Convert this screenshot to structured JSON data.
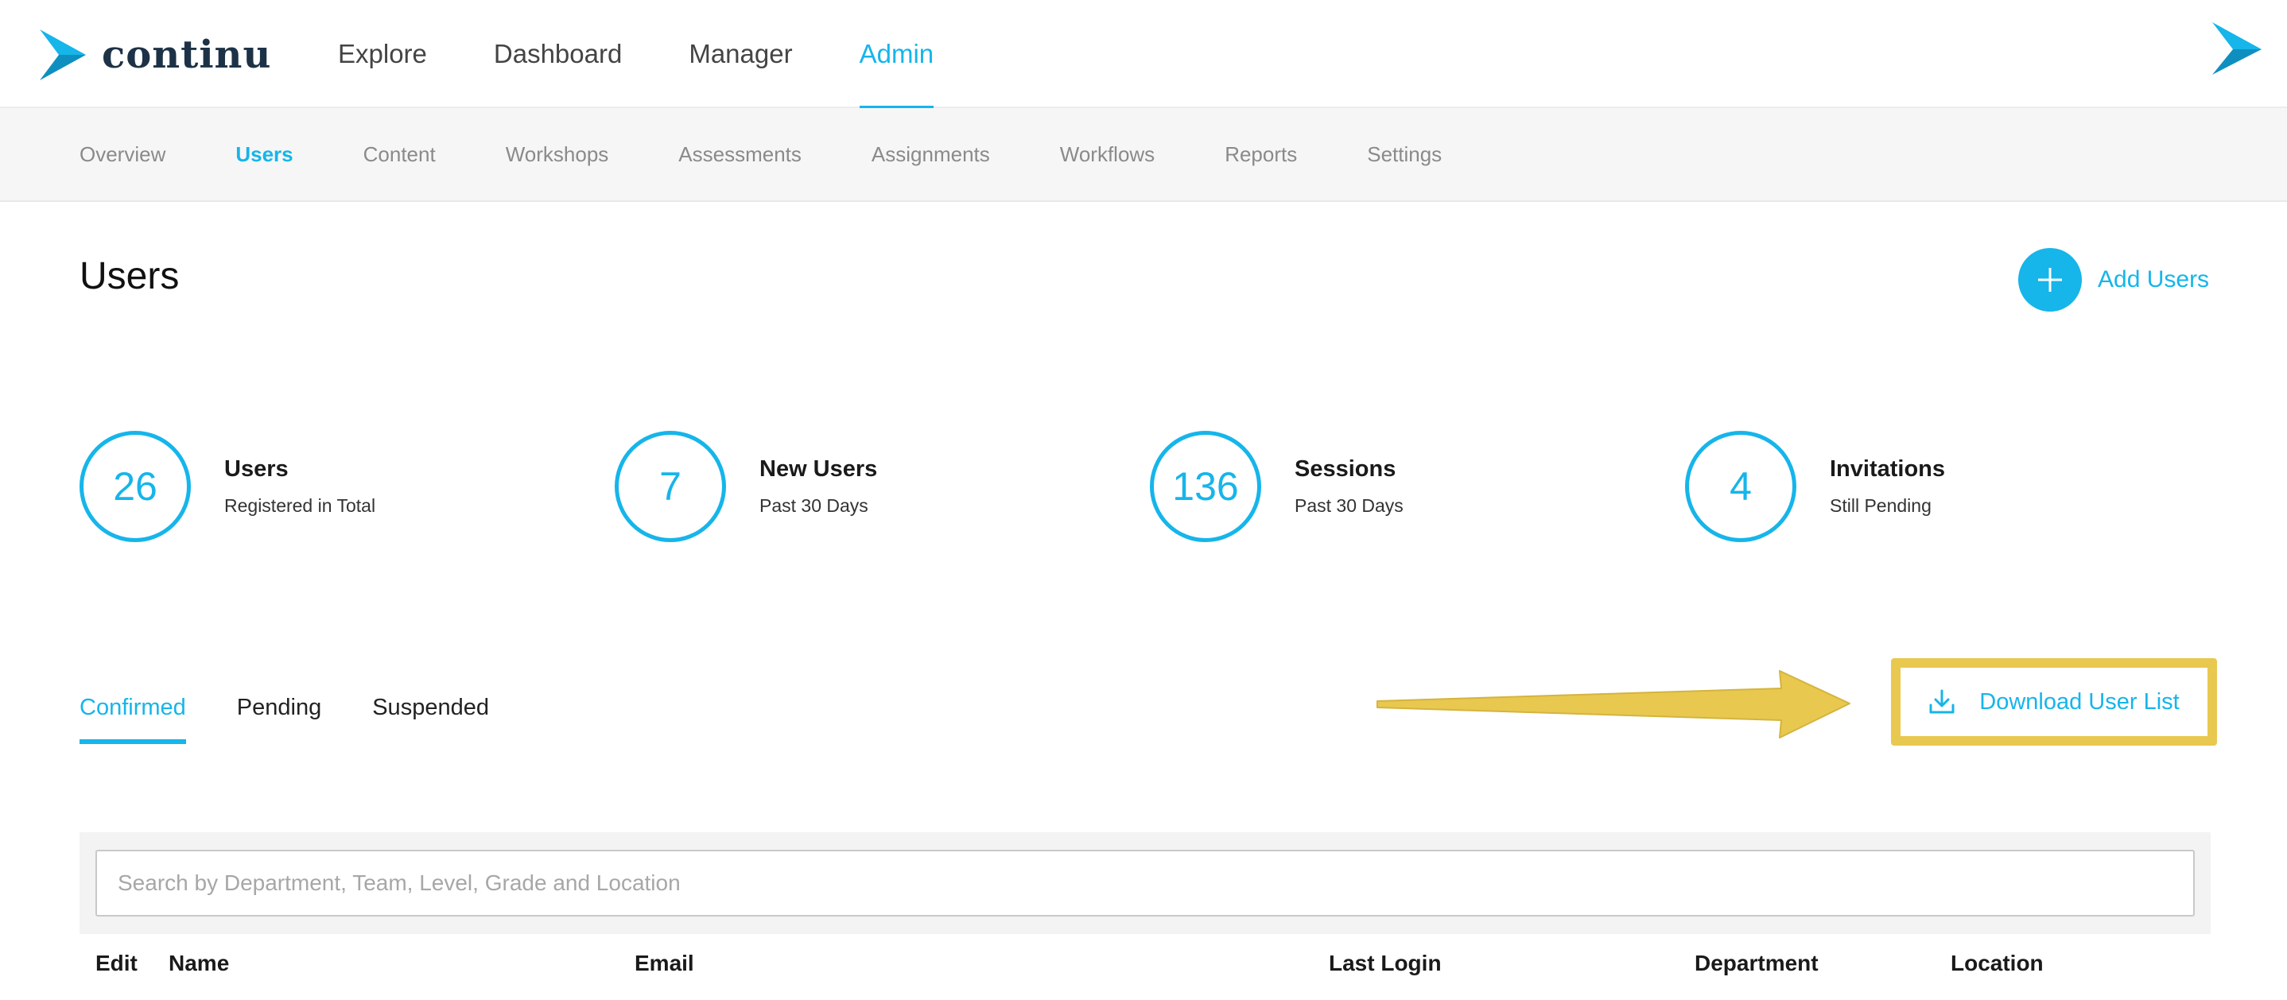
{
  "app": {
    "logo_text": "continu",
    "brand_color": "#16b5ea",
    "logo_icon": "continu-arrow-icon"
  },
  "main_nav": [
    {
      "label": "Explore",
      "active": false
    },
    {
      "label": "Dashboard",
      "active": false
    },
    {
      "label": "Manager",
      "active": false
    },
    {
      "label": "Admin",
      "active": true
    }
  ],
  "sub_nav": [
    {
      "label": "Overview",
      "active": false
    },
    {
      "label": "Users",
      "active": true
    },
    {
      "label": "Content",
      "active": false
    },
    {
      "label": "Workshops",
      "active": false
    },
    {
      "label": "Assessments",
      "active": false
    },
    {
      "label": "Assignments",
      "active": false
    },
    {
      "label": "Workflows",
      "active": false
    },
    {
      "label": "Reports",
      "active": false
    },
    {
      "label": "Settings",
      "active": false
    }
  ],
  "page": {
    "title": "Users",
    "add_button_label": "Add Users",
    "add_icon": "plus-icon"
  },
  "stats": [
    {
      "value": "26",
      "title": "Users",
      "subtitle": "Registered in Total"
    },
    {
      "value": "7",
      "title": "New Users",
      "subtitle": "Past 30 Days"
    },
    {
      "value": "136",
      "title": "Sessions",
      "subtitle": "Past 30 Days"
    },
    {
      "value": "4",
      "title": "Invitations",
      "subtitle": "Still Pending"
    }
  ],
  "tabs": [
    {
      "label": "Confirmed",
      "active": true
    },
    {
      "label": "Pending",
      "active": false
    },
    {
      "label": "Suspended",
      "active": false
    }
  ],
  "download": {
    "label": "Download User List",
    "icon": "download-icon",
    "highlight_color": "#e8c84f"
  },
  "search": {
    "placeholder": "Search by Department, Team, Level, Grade and Location",
    "value": ""
  },
  "table": {
    "columns": [
      "Edit",
      "Name",
      "Email",
      "Last Login",
      "Department",
      "Location"
    ]
  }
}
